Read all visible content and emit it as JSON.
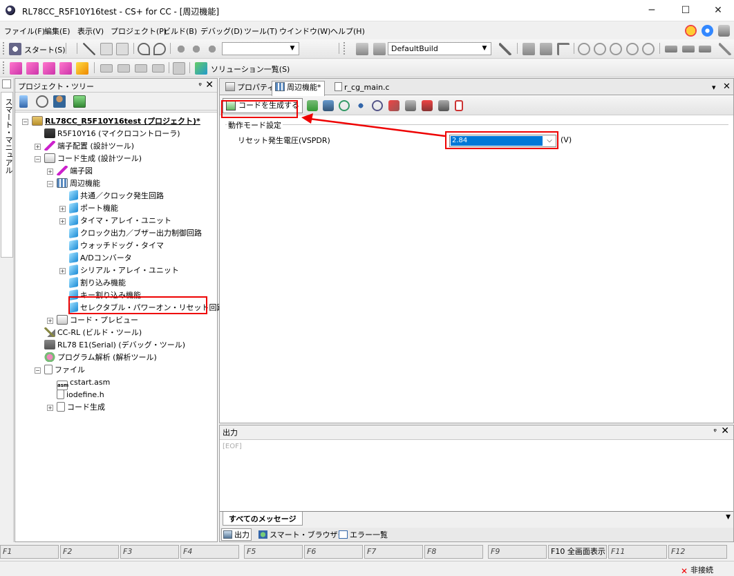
{
  "window": {
    "title": "RL78CC_R5F10Y16test - CS+ for CC - [周辺機能]",
    "minimize": "─",
    "maximize": "☐",
    "close": "✕"
  },
  "menu": [
    "ファイル(F)",
    "編集(E)",
    "表示(V)",
    "プロジェクト(P)",
    "ビルド(B)",
    "デバッグ(D)",
    "ツール(T)",
    "ウインドウ(W)",
    "ヘルプ(H)"
  ],
  "toolbar1": {
    "start_label": "スタート(S)",
    "build_config": "DefaultBuild"
  },
  "toolbar2": {
    "solution_label": "ソリューション一覧(S)"
  },
  "sidestrip": {
    "smart_manual": "スマート・マニュアル"
  },
  "tree": {
    "title": "プロジェクト・ツリー",
    "pin": "ᵠ",
    "close": "✕",
    "nodes": [
      "RL78CC_R5F10Y16test (プロジェクト)*",
      "R5F10Y16 (マイクロコントローラ)",
      "端子配置 (設計ツール)",
      "コード生成 (設計ツール)",
      "端子図",
      "周辺機能",
      "共通／クロック発生回路",
      "ポート機能",
      "タイマ・アレイ・ユニット",
      "クロック出力／ブザー出力制御回路",
      "ウォッチドッグ・タイマ",
      "A/Dコンバータ",
      "シリアル・アレイ・ユニット",
      "割り込み機能",
      "キー割り込み機能",
      "セレクタブル・パワーオン・リセット回路",
      "コード・プレビュー",
      "CC-RL (ビルド・ツール)",
      "RL78 E1(Serial) (デバッグ・ツール)",
      "プログラム解析 (解析ツール)",
      "ファイル",
      "cstart.asm",
      "iodefine.h",
      "コード生成"
    ]
  },
  "editor": {
    "tabs": [
      "プロパティ",
      "周辺機能*",
      "r_cg_main.c"
    ],
    "generate_code": "コードを生成する",
    "group_label": "動作モード設定",
    "property_label": "リセット発生電圧(VSPDR)",
    "selected_value": "2.84",
    "unit": "(V)",
    "menu_arrow": "▾",
    "close": "✕"
  },
  "output": {
    "title": "出力",
    "pin": "ᵠ",
    "close": "✕",
    "eof": "[EOF]",
    "message_tab": "すべてのメッセージ",
    "bottom_tabs": [
      "出力",
      "スマート・ブラウザー",
      "エラー一覧"
    ]
  },
  "fkeys": [
    "F1",
    "F2",
    "F3",
    "F4",
    "F5",
    "F6",
    "F7",
    "F8",
    "F9",
    "F10 全画面表示",
    "F11",
    "F12"
  ],
  "status": {
    "connection": "非接続"
  }
}
